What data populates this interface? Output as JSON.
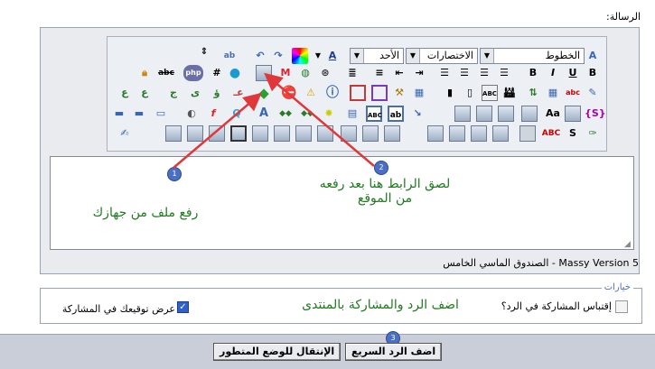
{
  "form": {
    "message_label": ":الرسالة",
    "editor_footer": "الصندوق الماسي الخامس - Massy Version 5"
  },
  "toolbar": {
    "font_select": "الخطوط",
    "shortcuts_select": "الاختصارات",
    "size_select": "الأحد",
    "color_letter": "A",
    "buttons_row2": [
      "abc",
      "#",
      "B",
      "I",
      "U",
      "B"
    ],
    "php_label": "php",
    "buttons_row4_abc": "ABC",
    "buttons_row4_s": "S"
  },
  "callouts": {
    "paste_link": "لصق الرابط هنا بعد رفعه من الموقع",
    "upload_file": "رفع ملف من جهازك",
    "add_reply": "اضف الرد والمشاركة بالمنتدى",
    "badge1": "1",
    "badge2": "2",
    "badge3": "3"
  },
  "options": {
    "legend": "خيارات",
    "quote_label": "إقتباس المشاركة في الرد؟",
    "signature_label": "عرض توقيعك في المشاركة"
  },
  "buttons": {
    "quick_reply": "اضف الرد السريع",
    "advanced_mode": "الإنتقال للوضع المتطور"
  },
  "colors": {
    "arrow": "#e0383a",
    "callout_text": "#1f7a1f",
    "badge": "#4a6fc4"
  }
}
